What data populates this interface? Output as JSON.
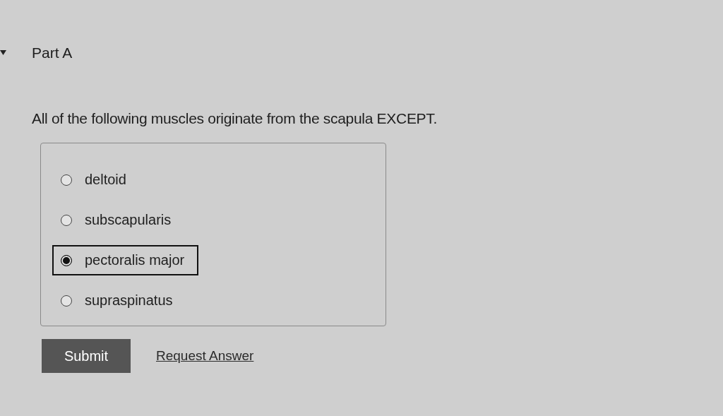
{
  "part": {
    "title": "Part A",
    "expanded": true
  },
  "question": "All of the following muscles originate from the scapula EXCEPT.",
  "options": [
    {
      "label": "deltoid",
      "selected": false
    },
    {
      "label": "subscapularis",
      "selected": false
    },
    {
      "label": "pectoralis major",
      "selected": true
    },
    {
      "label": "supraspinatus",
      "selected": false
    }
  ],
  "buttons": {
    "submit": "Submit",
    "request": "Request Answer"
  }
}
